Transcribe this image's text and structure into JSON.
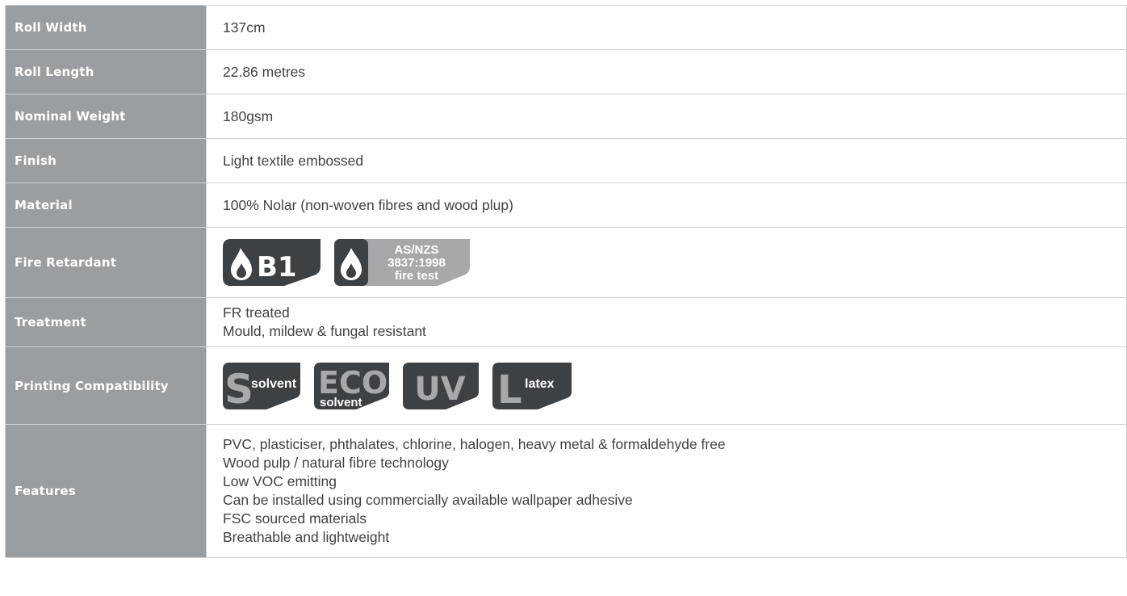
{
  "rows": [
    {
      "label": "Roll Width",
      "value": "137cm"
    },
    {
      "label": "Roll Length",
      "value": "22.86 metres"
    },
    {
      "label": "Nominal Weight",
      "value": "180gsm"
    },
    {
      "label": "Finish",
      "value": "Light textile embossed"
    },
    {
      "label": "Material",
      "value": "100% Nolar (non-woven fibres and wood plup)"
    },
    {
      "label": "Fire Retardant"
    },
    {
      "label": "Treatment"
    },
    {
      "label": "Printing Compatibility"
    },
    {
      "label": "Features"
    }
  ],
  "treatment_lines": [
    "FR treated",
    "Mould, mildew & fungal resistant"
  ],
  "fire_badges": {
    "b1": {
      "icon": "flame-icon",
      "text": "B1",
      "color": "#3d4144"
    },
    "asnzs": {
      "icon": "flame-icon",
      "line1": "AS/NZS",
      "line2": "3837:1998",
      "line3": "fire test",
      "color": "#a6a8aa"
    }
  },
  "print_badges": {
    "solvent": {
      "letter": "S",
      "word": "solvent"
    },
    "eco_solvent": {
      "top": "ECO",
      "bottom": "solvent"
    },
    "uv": {
      "text": "UV"
    },
    "latex": {
      "letter": "L",
      "word": "latex"
    },
    "color": "#3d4144",
    "letter_color": "#a6a8aa"
  },
  "feature_lines": [
    "PVC, plasticiser, phthalates, chlorine, halogen, heavy metal & formaldehyde free",
    "Wood pulp / natural fibre technology",
    "Low VOC emitting",
    "Can be installed using commercially available wallpaper adhesive",
    "FSC sourced materials",
    "Breathable and lightweight"
  ]
}
